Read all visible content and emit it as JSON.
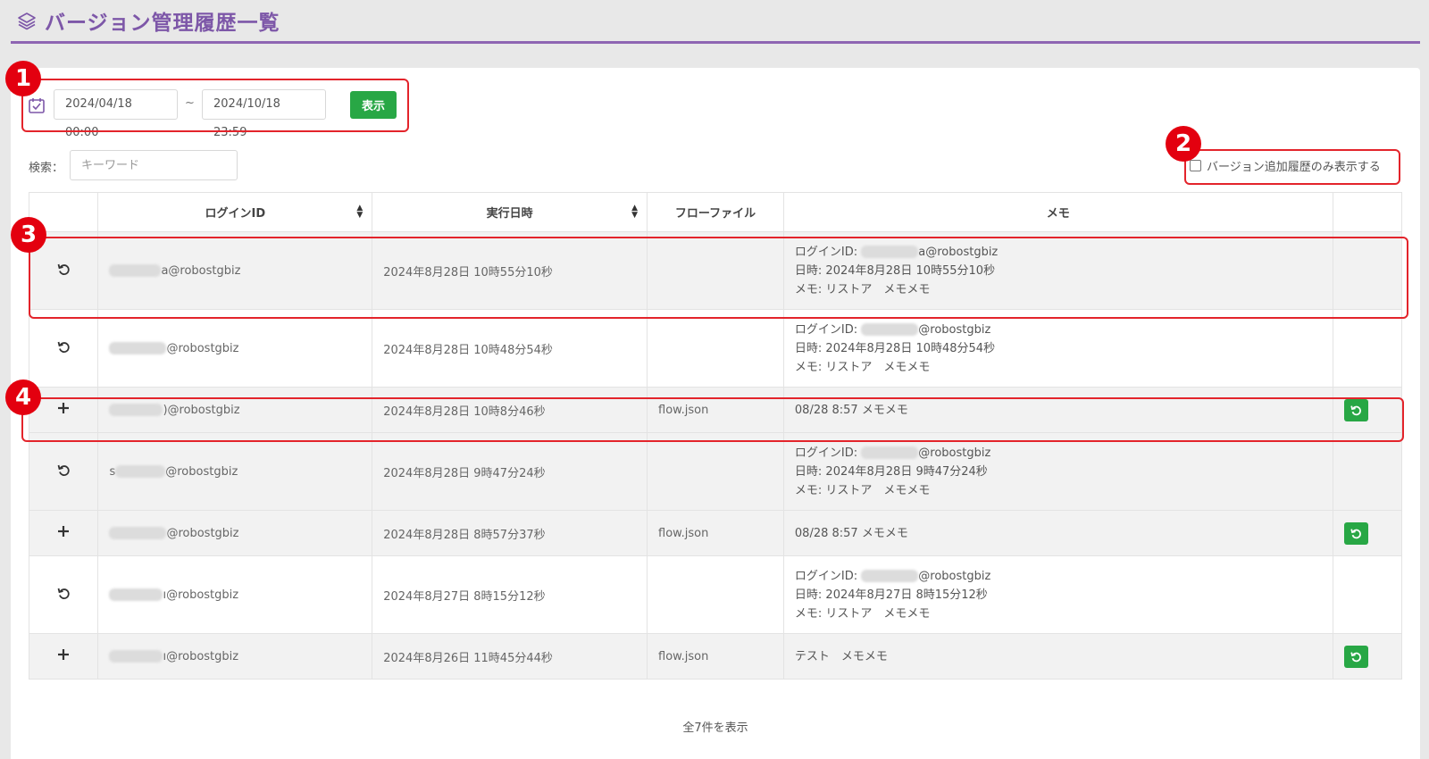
{
  "page": {
    "title": "バージョン管理履歴一覧"
  },
  "date_range": {
    "from": "2024/04/18 00:00",
    "separator": "~",
    "to": "2024/10/18 23:59",
    "show_button": "表示"
  },
  "search": {
    "label": "検索：",
    "placeholder": "キーワード"
  },
  "filter": {
    "label": "バージョン追加履歴のみ表示する",
    "checked": false
  },
  "table": {
    "headers": [
      "",
      "ログインID",
      "実行日時",
      "フローファイル",
      "メモ",
      ""
    ],
    "rows": [
      {
        "action_icon": "undo-icon",
        "login_suffix": "a@robostgbiz",
        "datetime": "2024年8月28日 10時55分10秒",
        "flow_file": "",
        "memo": [
          "ログインID: ",
          "a@robostgbiz",
          "日時: 2024年8月28日 10時55分10秒",
          "メモ: リストア　メモメモ"
        ],
        "has_restore": false
      },
      {
        "action_icon": "undo-icon",
        "login_suffix": "@robostgbiz",
        "datetime": "2024年8月28日 10時48分54秒",
        "flow_file": "",
        "memo": [
          "ログインID: ",
          "@robostgbiz",
          "日時: 2024年8月28日 10時48分54秒",
          "メモ: リストア　メモメモ"
        ],
        "has_restore": false
      },
      {
        "action_icon": "plus-icon",
        "login_suffix": ")@robostgbiz",
        "datetime": "2024年8月28日 10時8分46秒",
        "flow_file": "flow.json",
        "memo": [
          "08/28 8:57 メモメモ"
        ],
        "has_restore": true
      },
      {
        "action_icon": "undo-icon",
        "login_prefix": "s",
        "login_suffix": "@robostgbiz",
        "datetime": "2024年8月28日 9時47分24秒",
        "flow_file": "",
        "memo": [
          "ログインID: ",
          "@robostgbiz",
          "日時: 2024年8月28日 9時47分24秒",
          "メモ: リストア　メモメモ"
        ],
        "has_restore": false
      },
      {
        "action_icon": "plus-icon",
        "login_suffix": "@robostgbiz",
        "datetime": "2024年8月28日 8時57分37秒",
        "flow_file": "flow.json",
        "memo": [
          "08/28 8:57 メモメモ"
        ],
        "has_restore": true
      },
      {
        "action_icon": "undo-icon",
        "login_suffix": "ı@robostgbiz",
        "datetime": "2024年8月27日 8時15分12秒",
        "flow_file": "",
        "memo": [
          "ログインID: ",
          "@robostgbiz",
          "日時: 2024年8月27日 8時15分12秒",
          "メモ: リストア　メモメモ"
        ],
        "has_restore": false
      },
      {
        "action_icon": "plus-icon",
        "login_suffix": "ı@robostgbiz",
        "datetime": "2024年8月26日 11時45分44秒",
        "flow_file": "flow.json",
        "memo": [
          "テスト　メモメモ"
        ],
        "has_restore": true
      }
    ]
  },
  "footer": {
    "count_text": "全7件を表示"
  },
  "annotations": [
    "1",
    "2",
    "3",
    "4"
  ],
  "colors": {
    "accent_purple": "#7d57a8",
    "button_green": "#28a745",
    "annotation_red": "#e3242b"
  }
}
